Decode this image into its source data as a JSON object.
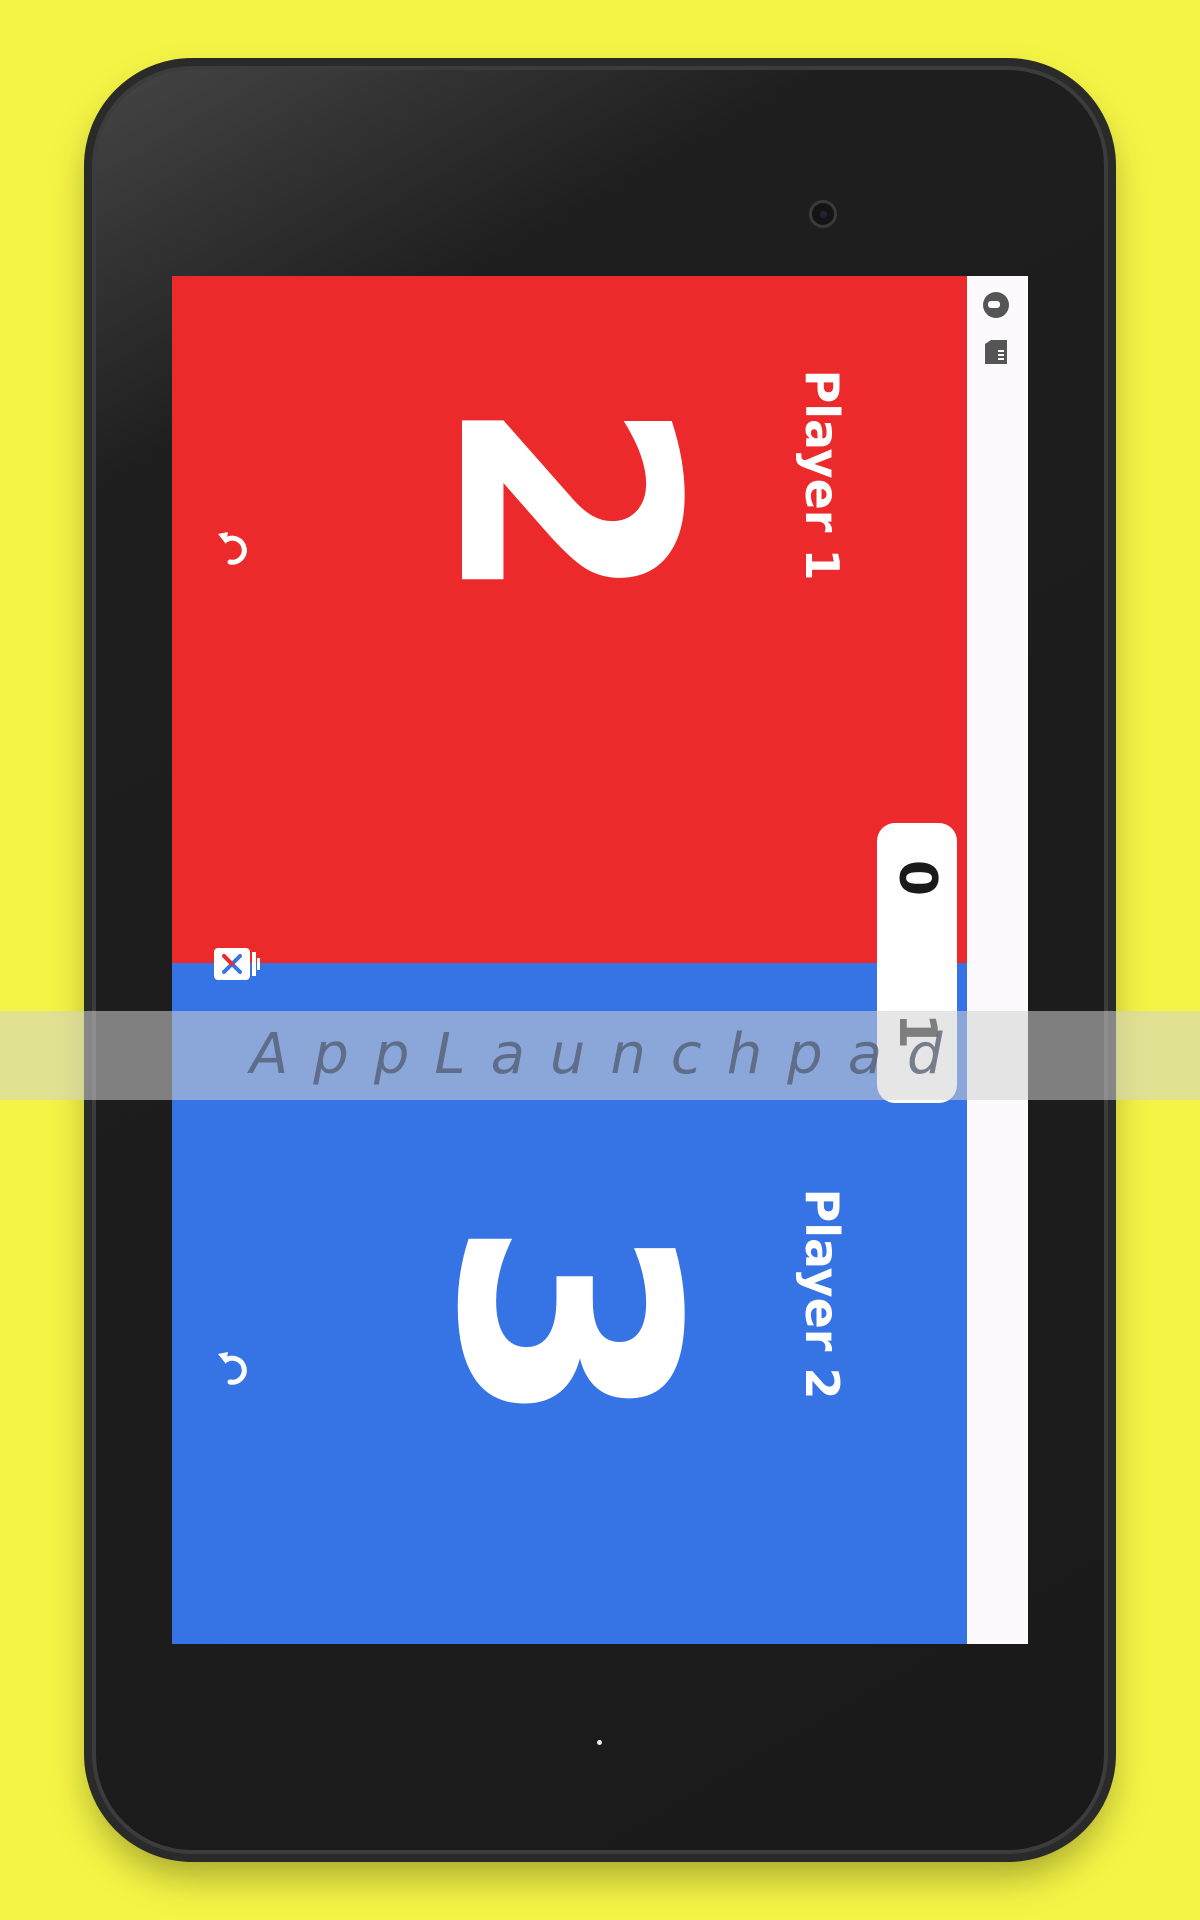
{
  "app": {
    "players": [
      {
        "label": "Player 1",
        "score": "2",
        "color": "#ec2a2b"
      },
      {
        "label": "Player 2",
        "score": "3",
        "color": "#3674e5"
      }
    ],
    "round_counter": {
      "top": "0",
      "bottom": "1"
    },
    "undo_icon": "undo-arrow-icon",
    "remove_icon": "remove-player-icon"
  },
  "status_bar": {
    "icons": [
      "status-circle-icon",
      "sd-card-icon"
    ]
  },
  "watermark": {
    "text": "AppLaunchpad"
  },
  "colors": {
    "background": "#f4f446",
    "player1": "#ec2a2b",
    "player2": "#3674e5",
    "status_bar": "#fdfafd"
  }
}
